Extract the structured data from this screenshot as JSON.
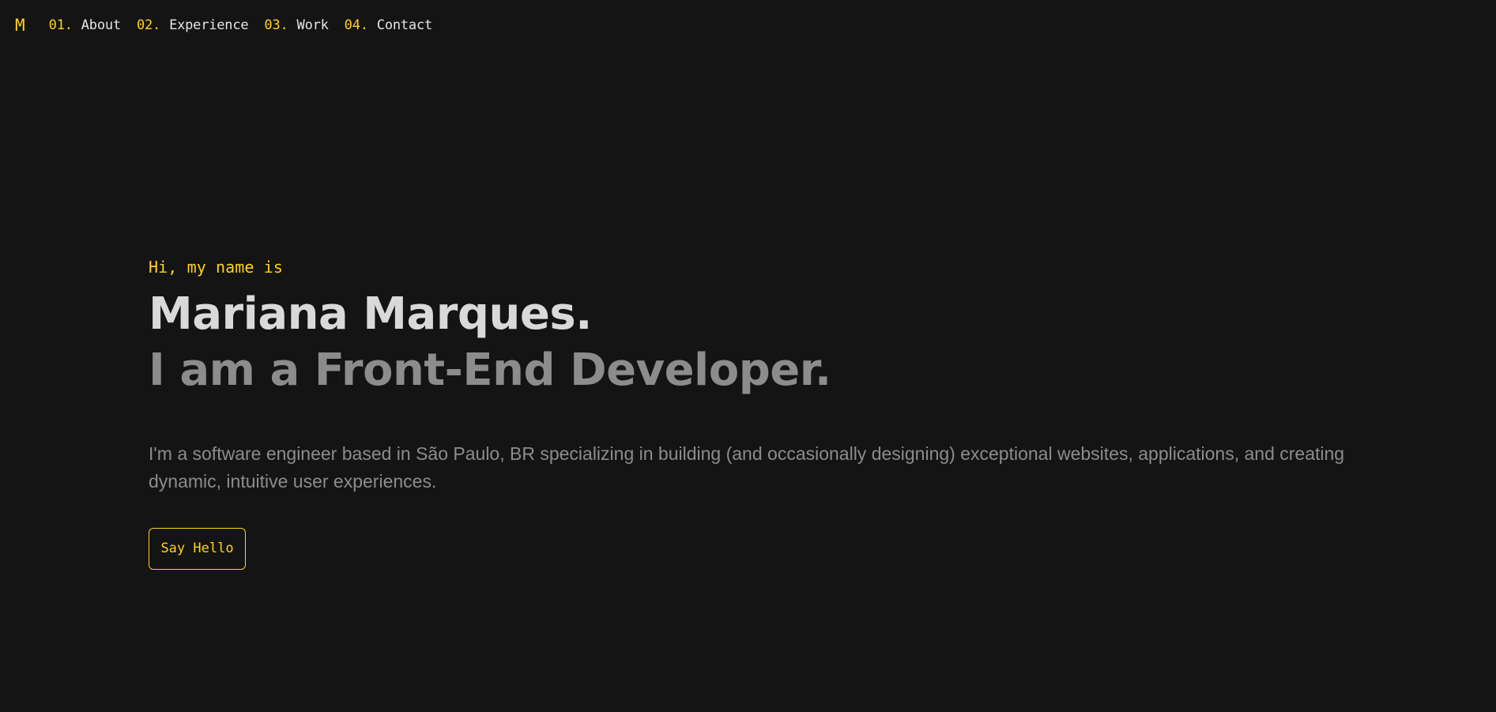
{
  "nav": {
    "logo": "M",
    "items": [
      {
        "num": "01.",
        "label": "About"
      },
      {
        "num": "02.",
        "label": "Experience"
      },
      {
        "num": "03.",
        "label": "Work"
      },
      {
        "num": "04.",
        "label": "Contact"
      }
    ]
  },
  "hero": {
    "greeting": "Hi, my name is",
    "name": "Mariana Marques.",
    "role": "I am a Front-End Developer.",
    "description": "I'm a software engineer based in São Paulo, BR specializing in building (and occasionally designing) exceptional websites, applications, and creating dynamic, intuitive user experiences.",
    "cta_label": "Say Hello"
  },
  "colors": {
    "background": "#141414",
    "accent": "#ffd21f",
    "heading": "#d9d9d9",
    "muted": "#8c8c8c"
  }
}
